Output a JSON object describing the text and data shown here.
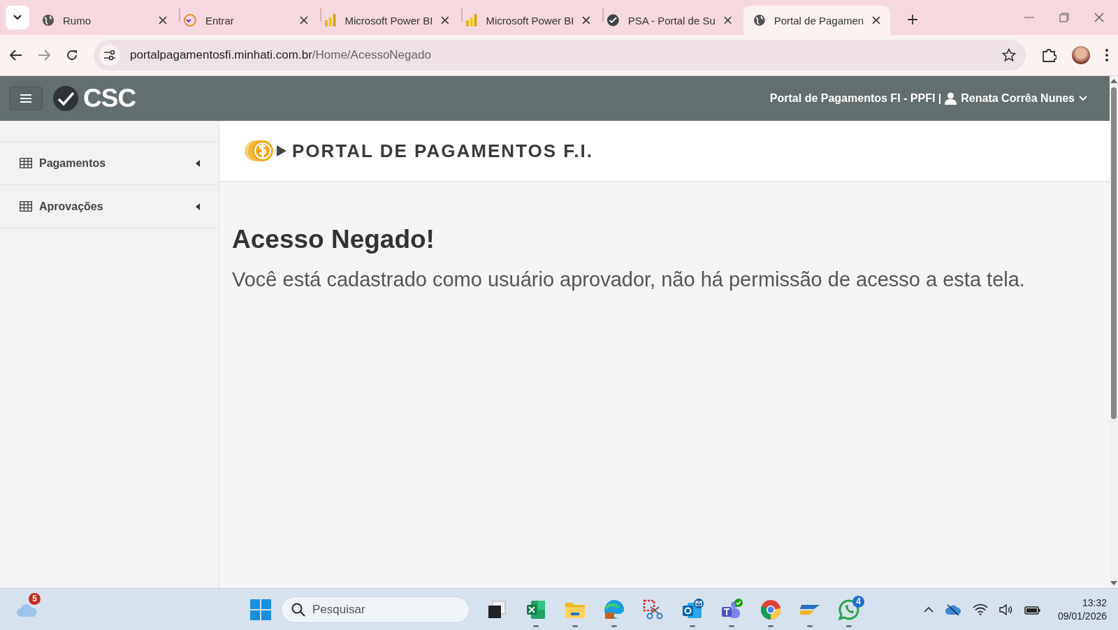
{
  "browser": {
    "tabs": [
      {
        "title": "Rumo",
        "kind": "globe",
        "selected": false
      },
      {
        "title": "Entrar",
        "kind": "v360",
        "selected": false
      },
      {
        "title": "Microsoft Power BI",
        "kind": "powerbi",
        "selected": false
      },
      {
        "title": "Microsoft Power BI",
        "kind": "powerbi",
        "selected": false
      },
      {
        "title": "PSA - Portal de Su",
        "kind": "check",
        "selected": false
      },
      {
        "title": "Portal de Pagamen",
        "kind": "globe",
        "selected": true
      }
    ],
    "address": {
      "host": "portalpagamentosfi.minhati.com.br",
      "path": "/Home/AcessoNegado"
    }
  },
  "app": {
    "logo": "CSC",
    "header_title": "Portal de Pagamentos FI - PPFI |",
    "user": "Renata Corrêa Nunes"
  },
  "sidebar": {
    "items": [
      {
        "label": "Pagamentos",
        "expanded": false
      },
      {
        "label": "Aprovações",
        "expanded": false
      }
    ]
  },
  "banner": "PORTAL DE PAGAMENTOS F.I.",
  "message": {
    "title": "Acesso Negado!",
    "text": "Você está cadastrado como usuário aprovador, não há permissão de acesso a esta tela."
  },
  "taskbar": {
    "weather_badge": "5",
    "search_placeholder": "Pesquisar",
    "apps": [
      {
        "kind": "taskview",
        "running": false
      },
      {
        "kind": "excel",
        "running": true
      },
      {
        "kind": "folder",
        "running": true
      },
      {
        "kind": "edge",
        "running": true
      },
      {
        "kind": "snip",
        "running": false
      },
      {
        "kind": "outlook",
        "running": true
      },
      {
        "kind": "teams",
        "running": true
      },
      {
        "kind": "chrome",
        "running": true
      },
      {
        "kind": "pen",
        "running": true
      },
      {
        "kind": "whatsapp",
        "running": true,
        "badge": "4"
      }
    ],
    "time": "13:32",
    "date": "09/01/2026"
  }
}
